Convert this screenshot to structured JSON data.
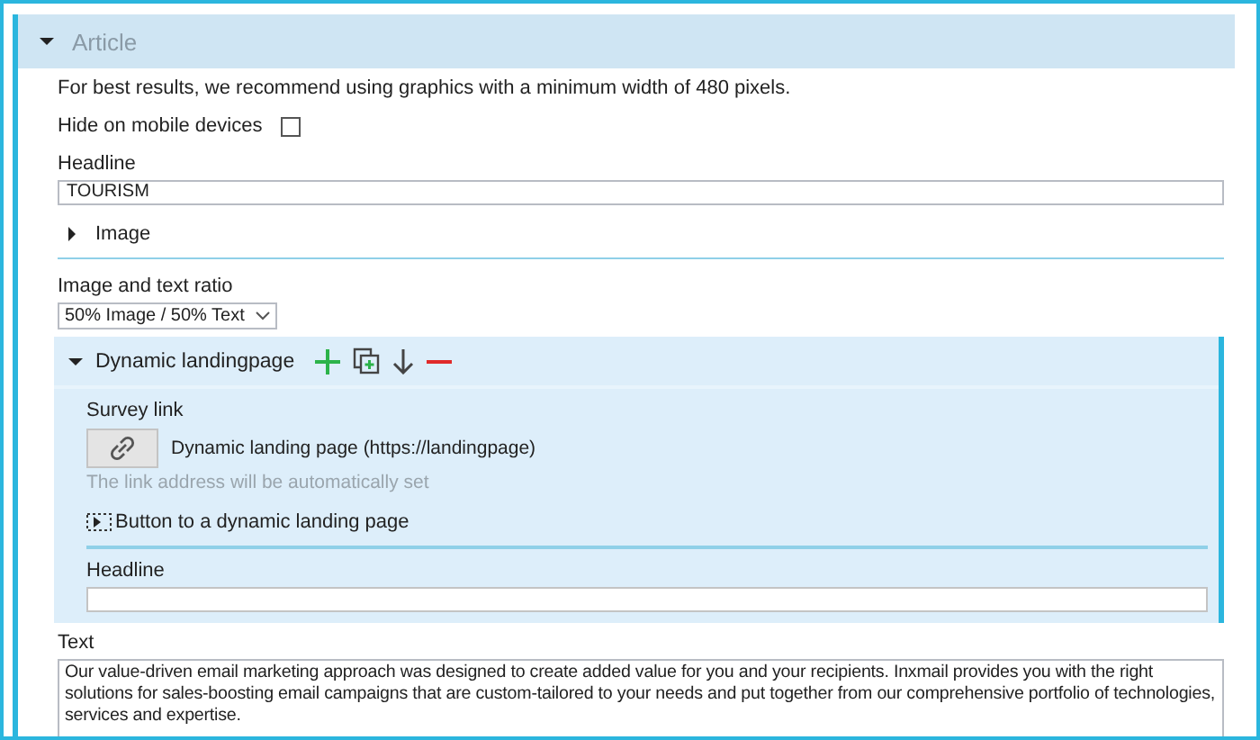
{
  "section": {
    "title": "Article",
    "expanded": true
  },
  "hint": "For best results, we recommend using graphics with a minimum width of 480 pixels.",
  "hide_on_mobile": {
    "label": "Hide on mobile devices",
    "checked": false
  },
  "headline": {
    "label": "Headline",
    "value": "TOURISM"
  },
  "image": {
    "label": "Image",
    "expanded": false
  },
  "ratio": {
    "label": "Image and text ratio",
    "value": "50% Image / 50% Text"
  },
  "dynamic": {
    "title": "Dynamic landingpage",
    "expanded": true,
    "survey_link": {
      "label": "Survey link",
      "link_text": "Dynamic landing page (https://landingpage)",
      "hint": "The link address will be automatically set"
    },
    "button_label": "Button to a dynamic landing page",
    "headline": {
      "label": "Headline"
    }
  },
  "text": {
    "label": "Text",
    "value": "Our value-driven email marketing approach was designed to create added value for you and your recipients. Inxmail provides you with the right solutions for sales-boosting email campaigns that are custom-tailored to your needs and put together from our comprehensive portfolio of technologies, services and expertise."
  }
}
